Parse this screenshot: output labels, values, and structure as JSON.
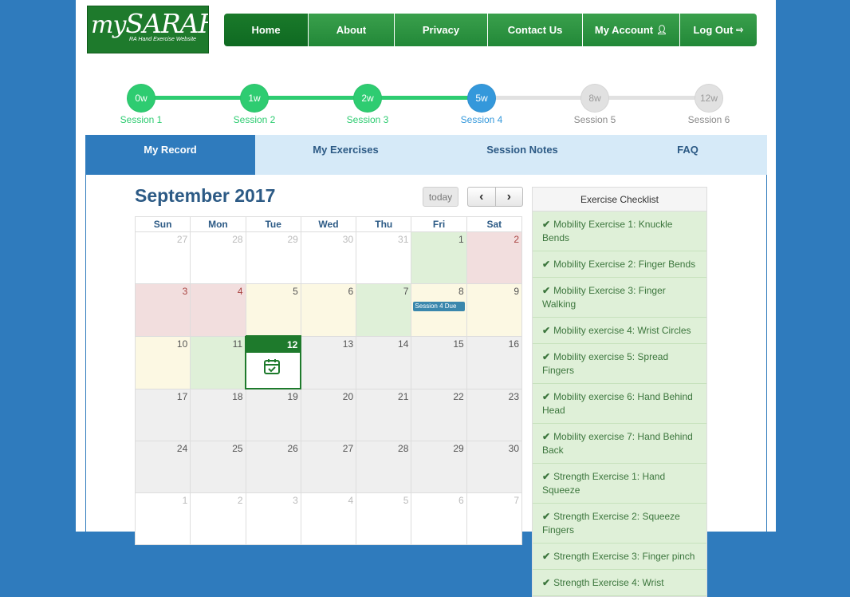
{
  "logo": {
    "brand_prefix": "my",
    "brand_main": "SARAH",
    "tagline": "RA Hand Exercise Website"
  },
  "nav": {
    "home": "Home",
    "about": "About",
    "privacy": "Privacy",
    "contact": "Contact Us",
    "account": "My Account",
    "logout": "Log Out"
  },
  "progress": {
    "steps": [
      {
        "week": "0w",
        "label": "Session 1",
        "state": "done"
      },
      {
        "week": "1w",
        "label": "Session 2",
        "state": "done"
      },
      {
        "week": "2w",
        "label": "Session 3",
        "state": "done"
      },
      {
        "week": "5w",
        "label": "Session 4",
        "state": "current"
      },
      {
        "week": "8w",
        "label": "Session 5",
        "state": "todo"
      },
      {
        "week": "12w",
        "label": "Session 6",
        "state": "todo"
      }
    ]
  },
  "tabs": {
    "record": "My Record",
    "exercises": "My Exercises",
    "notes": "Session Notes",
    "faq": "FAQ"
  },
  "calendar": {
    "title": "September 2017",
    "today_label": "today",
    "prev": "‹",
    "next": "›",
    "weekdays": [
      "Sun",
      "Mon",
      "Tue",
      "Wed",
      "Thu",
      "Fri",
      "Sat"
    ],
    "event_label": "Session 4 Due",
    "weeks": [
      [
        [
          "27",
          "other"
        ],
        [
          "28",
          "other"
        ],
        [
          "29",
          "other"
        ],
        [
          "30",
          "other"
        ],
        [
          "31",
          "other"
        ],
        [
          "1",
          "green"
        ],
        [
          "2",
          "red"
        ]
      ],
      [
        [
          "3",
          "red"
        ],
        [
          "4",
          "red"
        ],
        [
          "5",
          "yellow"
        ],
        [
          "6",
          "yellow"
        ],
        [
          "7",
          "green"
        ],
        [
          "8",
          "yellow"
        ],
        [
          "9",
          "yellow"
        ]
      ],
      [
        [
          "10",
          "yellow"
        ],
        [
          "11",
          "green"
        ],
        [
          "12",
          "today"
        ],
        [
          "13",
          "grey"
        ],
        [
          "14",
          "grey"
        ],
        [
          "15",
          "grey"
        ],
        [
          "16",
          "grey"
        ]
      ],
      [
        [
          "17",
          "grey"
        ],
        [
          "18",
          "grey"
        ],
        [
          "19",
          "grey"
        ],
        [
          "20",
          "grey"
        ],
        [
          "21",
          "grey"
        ],
        [
          "22",
          "grey"
        ],
        [
          "23",
          "grey"
        ]
      ],
      [
        [
          "24",
          "grey"
        ],
        [
          "25",
          "grey"
        ],
        [
          "26",
          "grey"
        ],
        [
          "27",
          "grey"
        ],
        [
          "28",
          "grey"
        ],
        [
          "29",
          "grey"
        ],
        [
          "30",
          "grey"
        ]
      ],
      [
        [
          "1",
          "other"
        ],
        [
          "2",
          "other"
        ],
        [
          "3",
          "other"
        ],
        [
          "4",
          "other"
        ],
        [
          "5",
          "other"
        ],
        [
          "6",
          "other"
        ],
        [
          "7",
          "other"
        ]
      ]
    ]
  },
  "checklist": {
    "title": "Exercise Checklist",
    "items": [
      "Mobility Exercise 1: Knuckle Bends",
      "Mobility Exercise 2: Finger Bends",
      "Mobility Exercise 3: Finger Walking",
      "Mobility exercise 4: Wrist Circles",
      "Mobility exercise 5: Spread Fingers",
      "Mobility exercise 6: Hand Behind Head",
      "Mobility exercise 7: Hand Behind Back",
      "Strength Exercise 1: Hand Squeeze",
      "Strength Exercise 2: Squeeze Fingers",
      "Strength Exercise 3: Finger pinch",
      "Strength Exercise 4: Wrist"
    ]
  },
  "colors": {
    "background": "#2f7bbd",
    "nav_green": "#228838",
    "done": "#2ecc71",
    "current": "#3498db",
    "today": "#1e7a2c"
  }
}
